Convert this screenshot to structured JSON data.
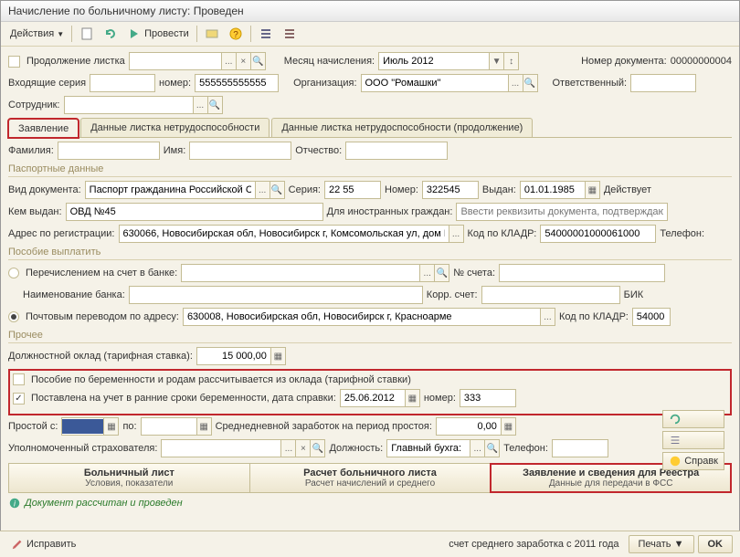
{
  "title": "Начисление по больничному листу: Проведен",
  "toolbar": {
    "actions": "Действия",
    "run": "Провести"
  },
  "top": {
    "continuation": "Продолжение листка",
    "month_lbl": "Месяц начисления:",
    "month_val": "Июль 2012",
    "docnum_lbl": "Номер документа:",
    "docnum_val": "00000000004",
    "in_series_lbl": "Входящие серия",
    "in_num_lbl": "номер:",
    "in_num_val": "555555555555",
    "org_lbl": "Организация:",
    "org_val": "ООО \"Ромашки\"",
    "resp_lbl": "Ответственный:",
    "emp_lbl": "Сотрудник:"
  },
  "tabs": {
    "t1": "Заявление",
    "t2": "Данные листка нетрудоспособности",
    "t3": "Данные листка нетрудоспособности (продолжение)"
  },
  "fio": {
    "fam_lbl": "Фамилия:",
    "name_lbl": "Имя:",
    "otch_lbl": "Отчество:"
  },
  "passport": {
    "section": "Паспортные данные",
    "type_lbl": "Вид документа:",
    "type_val": "Паспорт гражданина Российской С",
    "ser_lbl": "Серия:",
    "ser_val": "22 55",
    "num_lbl": "Номер:",
    "num_val": "322545",
    "issued_lbl": "Выдан:",
    "issued_val": "01.01.1985",
    "valid_lbl": "Действует",
    "by_lbl": "Кем выдан:",
    "by_val": "ОВД №45",
    "foreign_lbl": "Для иностранных граждан:",
    "foreign_ph": "Ввести реквизиты документа, подтверждаю...",
    "addr_lbl": "Адрес по регистрации:",
    "addr_val": "630066, Новосибирская обл, Новосибирск г, Комсомольская ул, дом N:",
    "kladr_lbl": "Код по КЛАДР:",
    "kladr_val": "54000001000061000",
    "tel_lbl": "Телефон:"
  },
  "payout": {
    "section": "Пособие выплатить",
    "bank_radio": "Перечислением на счет в банке:",
    "acct_lbl": "№ счета:",
    "bank_name_lbl": "Наименование банка:",
    "korr_lbl": "Корр. счет:",
    "bik_lbl": "БИК",
    "post_radio": "Почтовым переводом по адресу:",
    "post_val": "630008, Новосибирская обл, Новосибирск г, Красноарме",
    "kladr2_lbl": "Код по КЛАДР:",
    "kladr2_val": "54000"
  },
  "other": {
    "section": "Прочее",
    "salary_lbl": "Должностной оклад (тарифная ставка):",
    "salary_val": "15 000,00",
    "preg_cb": "Пособие по беременности и родам рассчитывается из оклада (тарифной ставки)",
    "reg_cb": "Поставлена на учет в ранние сроки беременности, дата справки:",
    "reg_date": "25.06.2012",
    "reg_num_lbl": "номер:",
    "reg_num_val": "333",
    "idle_from_lbl": "Простой с:",
    "idle_to_lbl": "по:",
    "avg_lbl": "Среднедневной заработок на период простоя:",
    "avg_val": "0,00",
    "insurer_lbl": "Уполномоченный страхователя:",
    "pos_lbl": "Должность:",
    "pos_val": "Главный бухга:",
    "tel_lbl": "Телефон:"
  },
  "ftabs": {
    "t1": "Больничный лист",
    "s1": "Условия, показатели",
    "t2": "Расчет больничного листа",
    "s2": "Расчет начислений и среднего",
    "t3": "Заявление и сведения для Реестра",
    "s3": "Данные для передачи в ФСС"
  },
  "status": "Документ рассчитан и проведен",
  "right": {
    "refresh": "",
    "list": "",
    "help": "Справк"
  },
  "bottom": {
    "fix": "Исправить",
    "calc": "счет среднего заработка с 2011 года",
    "print": "Печать",
    "ok": "OK"
  }
}
